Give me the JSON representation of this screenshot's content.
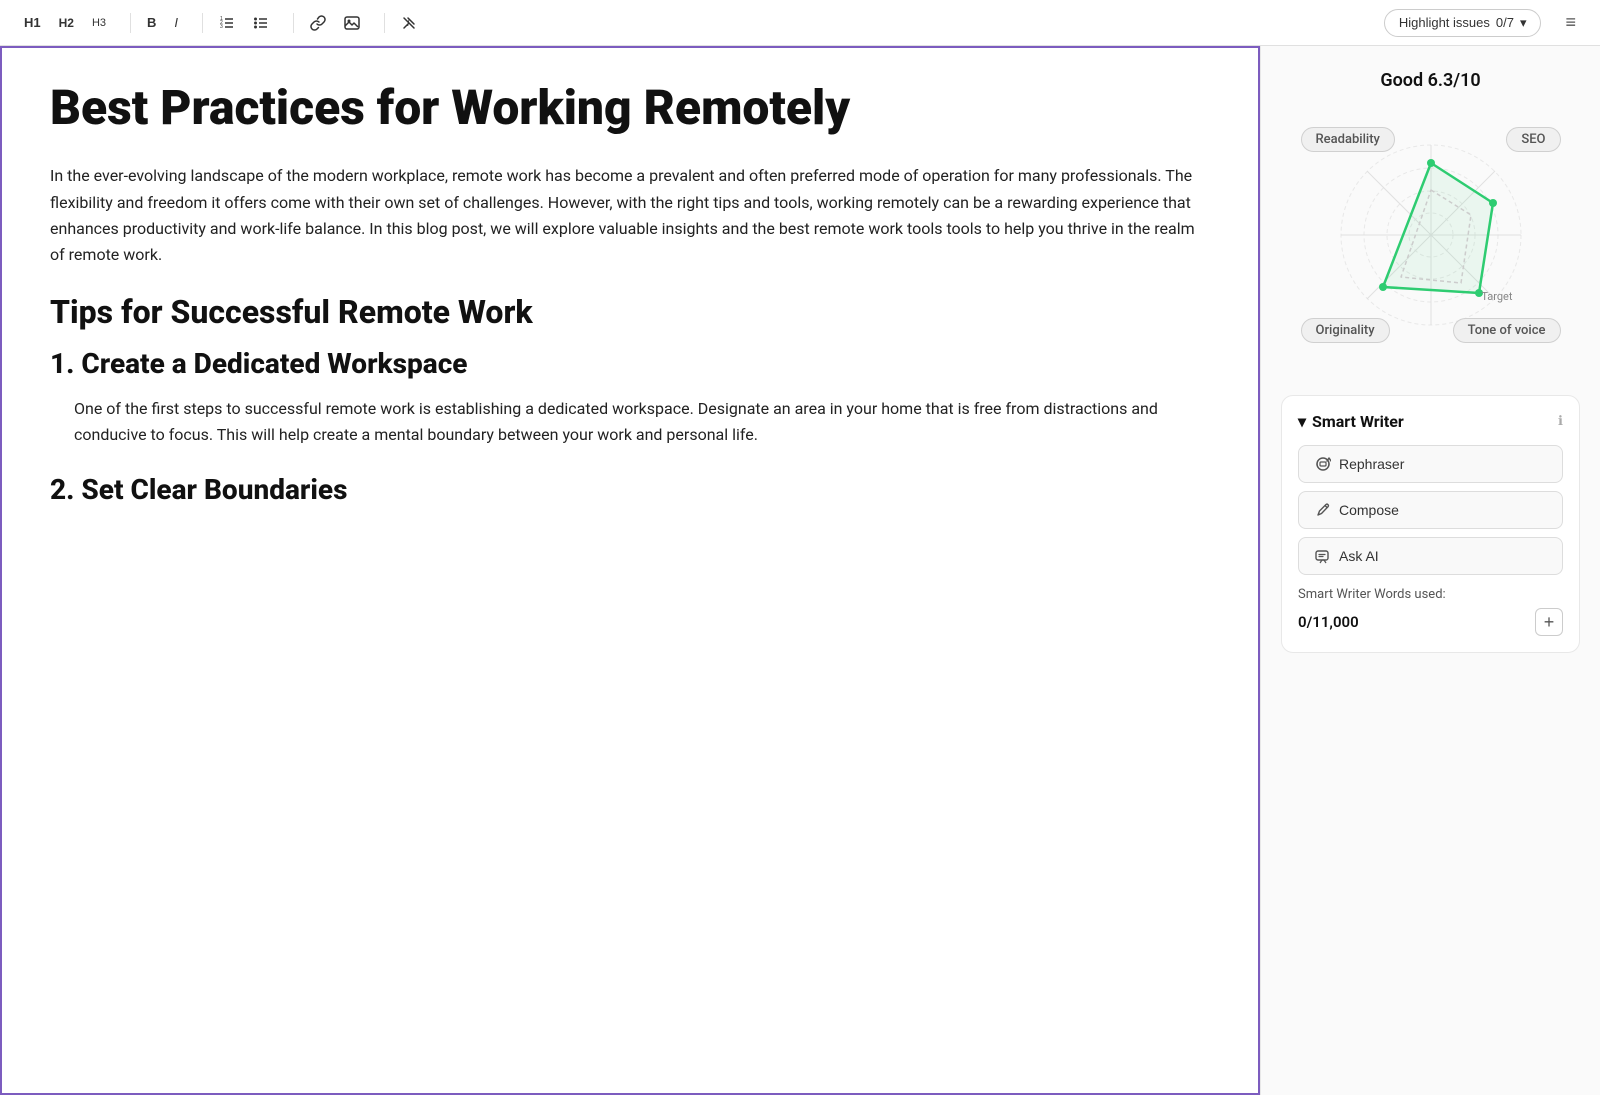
{
  "toolbar": {
    "h1_label": "H1",
    "h2_label": "H2",
    "h3_label": "H3",
    "bold_label": "B",
    "italic_label": "I",
    "highlight_label": "Highlight issues",
    "highlight_count": "0/7",
    "menu_icon": "≡"
  },
  "editor": {
    "title": "Best Practices for Working Remotely",
    "paragraph1": "In the ever-evolving landscape of the modern workplace, remote work has become a prevalent and often preferred mode of operation for many professionals. The flexibility and freedom it offers come with their own set of challenges. However, with the right tips and tools, working remotely can be a rewarding experience that enhances productivity and work-life balance. In this blog post, we will explore valuable insights and the best remote work tools tools to help you thrive in the realm of remote work.",
    "h2_1": "Tips for Successful Remote Work",
    "h3_1": "1. Create a Dedicated Workspace",
    "paragraph2": "One of the first steps to successful remote work is establishing a dedicated workspace. Designate an area in your home that is free from distractions and conducive to focus. This will help create a mental boundary between your work and personal life.",
    "h3_2": "2. Set Clear Boundaries"
  },
  "right_panel": {
    "score": {
      "label": "Good",
      "value": "6.3",
      "max": "/10"
    },
    "radar": {
      "readability_label": "Readability",
      "seo_label": "SEO",
      "originality_label": "Originality",
      "tone_label": "Tone of voice",
      "target_label": "Target"
    },
    "smart_writer": {
      "toggle_label": "▾",
      "title": "Smart Writer",
      "info_label": "ℹ",
      "rephraser_label": "Rephraser",
      "compose_label": "Compose",
      "ask_ai_label": "Ask AI",
      "words_used_label": "Smart Writer Words used:",
      "words_count": "0",
      "words_max": "/11,000",
      "add_btn_label": "+"
    },
    "accent_color": "#2ecc71",
    "radar_stroke_color": "#2ecc71",
    "border_color": "#7c5cbf"
  }
}
